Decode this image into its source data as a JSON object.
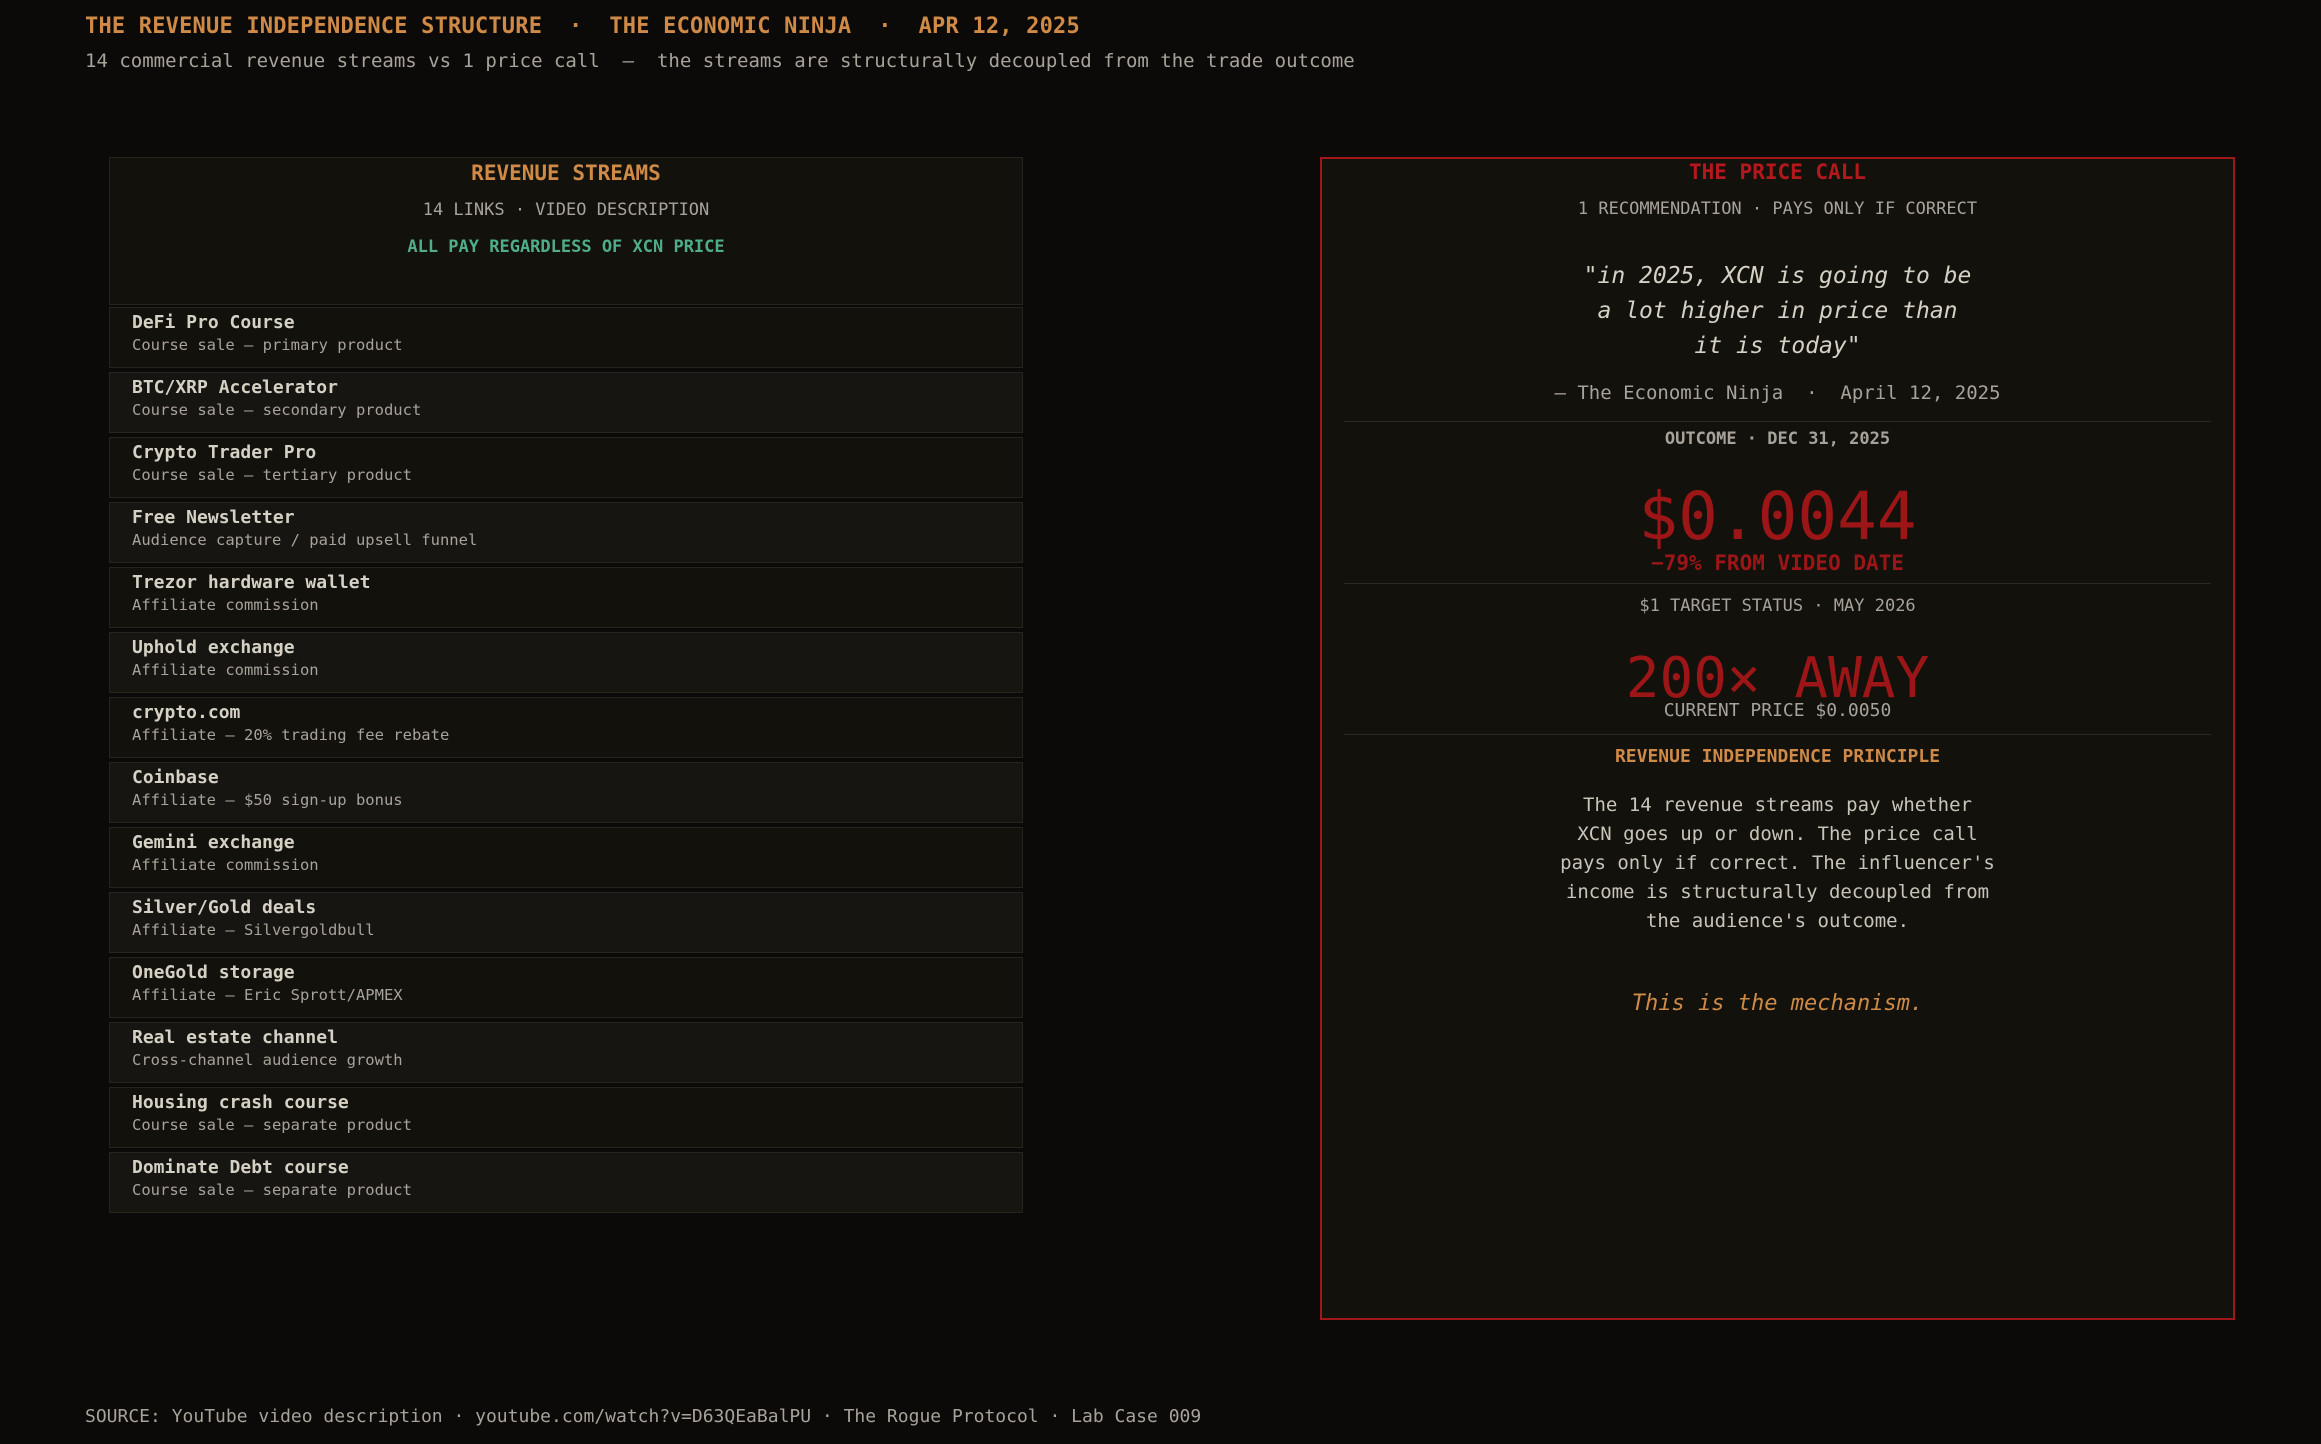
{
  "header": {
    "title": "THE REVENUE INDEPENDENCE STRUCTURE  ·  THE ECONOMIC NINJA  ·  APR 12, 2025",
    "subtitle": "14 commercial revenue streams vs 1 price call  —  the streams are structurally decoupled from the trade outcome"
  },
  "streams_panel": {
    "title": "REVENUE STREAMS",
    "subtitle": "14 LINKS · VIDEO DESCRIPTION",
    "note": "ALL PAY REGARDLESS OF XCN PRICE",
    "items": [
      {
        "name": "DeFi Pro Course",
        "desc": "Course sale — primary product"
      },
      {
        "name": "BTC/XRP Accelerator",
        "desc": "Course sale — secondary product"
      },
      {
        "name": "Crypto Trader Pro",
        "desc": "Course sale — tertiary product"
      },
      {
        "name": "Free Newsletter",
        "desc": "Audience capture / paid upsell funnel"
      },
      {
        "name": "Trezor hardware wallet",
        "desc": "Affiliate commission"
      },
      {
        "name": "Uphold exchange",
        "desc": "Affiliate commission"
      },
      {
        "name": "crypto.com",
        "desc": "Affiliate — 20% trading fee rebate"
      },
      {
        "name": "Coinbase",
        "desc": "Affiliate — $50 sign-up bonus"
      },
      {
        "name": "Gemini exchange",
        "desc": "Affiliate commission"
      },
      {
        "name": "Silver/Gold deals",
        "desc": "Affiliate — Silvergoldbull"
      },
      {
        "name": "OneGold storage",
        "desc": "Affiliate — Eric Sprott/APMEX"
      },
      {
        "name": "Real estate channel",
        "desc": "Cross-channel audience growth"
      },
      {
        "name": "Housing crash course",
        "desc": "Course sale — separate product"
      },
      {
        "name": "Dominate Debt course",
        "desc": "Course sale — separate product"
      }
    ]
  },
  "price_call": {
    "title": "THE PRICE CALL",
    "subtitle": "1 RECOMMENDATION · PAYS ONLY IF CORRECT",
    "quote": "\"in 2025, XCN is going to be\na lot higher in price than\nit is today\"",
    "attribution": "— The Economic Ninja  ·  April 12, 2025",
    "outcome_label": "OUTCOME · DEC 31, 2025",
    "outcome_value": "$0.0044",
    "outcome_change": "−79% FROM VIDEO DATE",
    "target_label": "$1 TARGET STATUS · MAY 2026",
    "target_value": "200× AWAY",
    "current_price": "CURRENT PRICE $0.0050",
    "principle_title": "REVENUE INDEPENDENCE PRINCIPLE",
    "principle_body": "The 14 revenue streams pay whether\nXCN goes up or down. The price call\npays only if correct. The influencer's\nincome is structurally decoupled from\nthe audience's outcome.",
    "mechanism": "This is the mechanism."
  },
  "footer": {
    "source": "SOURCE: YouTube video description · youtube.com/watch?v=D63QEaBalPU · The Rogue Protocol · Lab Case 009"
  },
  "colors": {
    "accent_orange": "#cf8a47",
    "accent_red": "#b3191c",
    "accent_green": "#4fae89",
    "background": "#0b0a09"
  }
}
